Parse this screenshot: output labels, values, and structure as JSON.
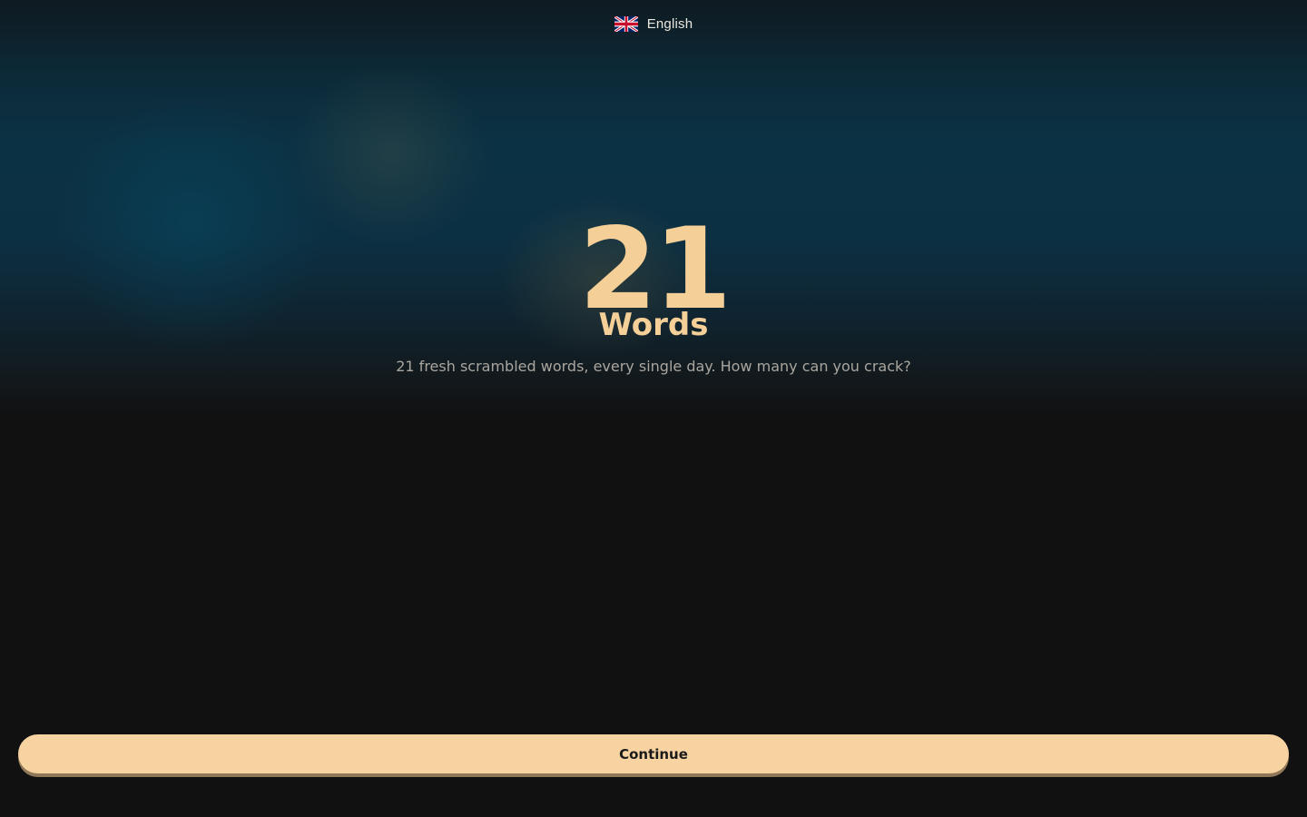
{
  "language": {
    "label": "English",
    "flag_icon": "uk-flag-icon"
  },
  "logo": {
    "number": "21",
    "word": "Words"
  },
  "tagline": "21 fresh scrambled words, every single day. How many can you crack?",
  "continue_label": "Continue",
  "colors": {
    "accent": "#f6d3a1",
    "logo": "#f4cf97",
    "background": "#111112",
    "gradient_top": "#0b3244"
  }
}
